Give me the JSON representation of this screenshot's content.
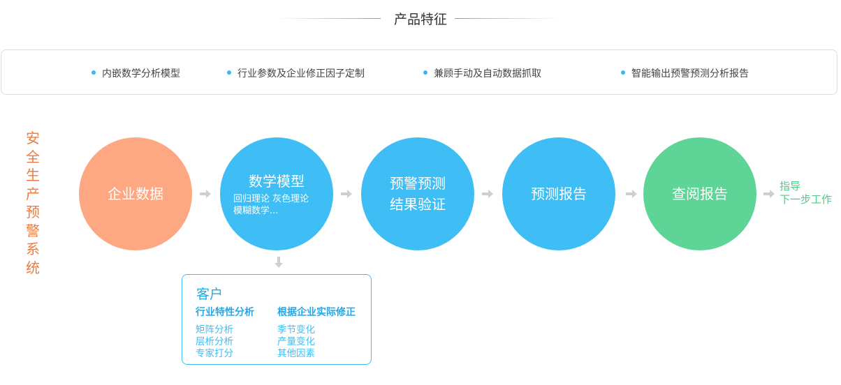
{
  "header": {
    "title": "产品特征"
  },
  "features": [
    "内嵌数学分析模型",
    "行业参数及企业修正因子定制",
    "兼顾手动及自动数据抓取",
    "智能输出预警预测分析报告"
  ],
  "side_label": "安全生产预警系统",
  "flow": {
    "step1": {
      "label": "企业数据"
    },
    "step2": {
      "label": "数学模型",
      "detail_line1": "回归理论  灰色理论",
      "detail_line2": "模糊数学..."
    },
    "step3": {
      "line1": "预警预测",
      "line2": "结果验证"
    },
    "step4": {
      "label": "预测报告"
    },
    "step5": {
      "label": "查阅报告"
    },
    "next": {
      "line1": "指导",
      "line2": "下一步工作"
    }
  },
  "customer": {
    "title": "客户",
    "col1": {
      "heading": "行业特性分析",
      "items": [
        "矩阵分析",
        "层析分析",
        "专家打分"
      ]
    },
    "col2": {
      "heading": "根据企业实际修正",
      "items": [
        "季节变化",
        "产量变化",
        "其他因素"
      ]
    }
  },
  "colors": {
    "orange": "#fda882",
    "blue": "#3ebef4",
    "green": "#5fd497",
    "side_label": "#f07a3d",
    "arrow": "#cfcfcf"
  }
}
